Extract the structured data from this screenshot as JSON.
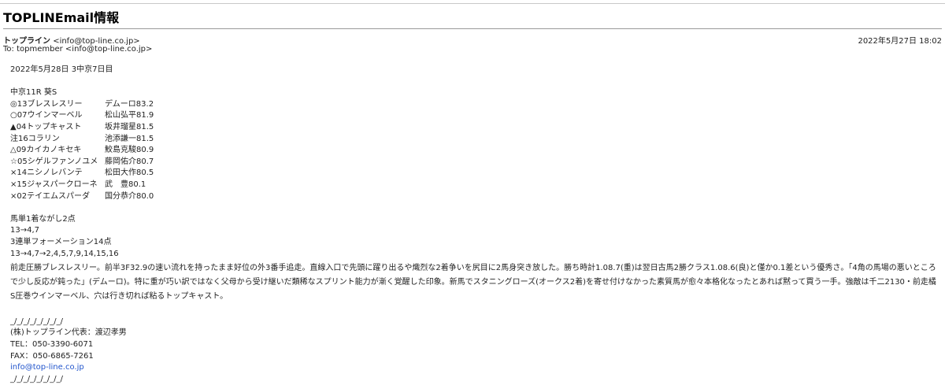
{
  "email": {
    "subject": "TOPLINEmail情報",
    "from_name": "トップライン",
    "from_addr": "<info@top-line.co.jp>",
    "to_label": "To:",
    "to_value": "topmember <info@top-line.co.jp>",
    "date": "2022年5月27日 18:02"
  },
  "body": {
    "date_line": "2022年5月28日 3中京7日目",
    "race_title": "中京11R 葵S",
    "horses": [
      {
        "horse": "◎13ブレスレスリー",
        "jockey": "デムーロ83.2"
      },
      {
        "horse": "○07ウインマーベル",
        "jockey": "松山弘平81.9"
      },
      {
        "horse": "▲04トップキャスト",
        "jockey": "坂井瑠星81.5"
      },
      {
        "horse": "注16コラリン",
        "jockey": "池添謙一81.5"
      },
      {
        "horse": "△09カイカノキセキ",
        "jockey": "鮫島克駿80.9"
      },
      {
        "horse": "☆05シゲルファンノユメ",
        "jockey": "藤岡佑介80.7"
      },
      {
        "horse": "×14ニシノレバンテ",
        "jockey": "松田大作80.5"
      },
      {
        "horse": "×15ジャスパークローネ",
        "jockey": "武　豊80.1"
      },
      {
        "horse": "×02テイエムスパーダ",
        "jockey": "国分恭介80.0"
      }
    ],
    "bet1_title": "馬単1着ながし2点",
    "bet1_detail": "13→4,7",
    "bet2_title": "3連単フォーメーション14点",
    "bet2_detail": "13→4,7→2,4,5,7,9,14,15,16",
    "comment": "前走圧勝ブレスレスリー。前半3F32.9の速い流れを持ったまま好位の外3番手追走。直線入口で先頭に躍り出るや熾烈な2着争いを尻目に2馬身突き放した。勝ち時計1.08.7(重)は翌日古馬2勝クラス1.08.6(良)と僅か0.1差という優秀さ。「4角の馬場の悪いところで少し反応が鈍った」(デムーロ)。特に重が巧い訳ではなく父母から受け継いだ類稀なスプリント能力が漸く覚醒した印象。新馬でスタニングローズ(オークス2着)を寄せ付けなかった素質馬が愈々本格化なったとあれば黙って買う一手。強敵は千二2130・前走橘S圧巻ウインマーベル、穴は行き切れば粘るトップキャスト。",
    "sig_line_top": "_/_/_/_/_/_/_/_/",
    "sig_company": "(株)トップライン代表：渡辺孝男",
    "sig_tel": "TEL：050-3390-6071",
    "sig_fax": "FAX：050-6865-7261",
    "sig_email": "info@top-line.co.jp",
    "sig_line_bottom": "_/_/_/_/_/_/_/_/"
  }
}
